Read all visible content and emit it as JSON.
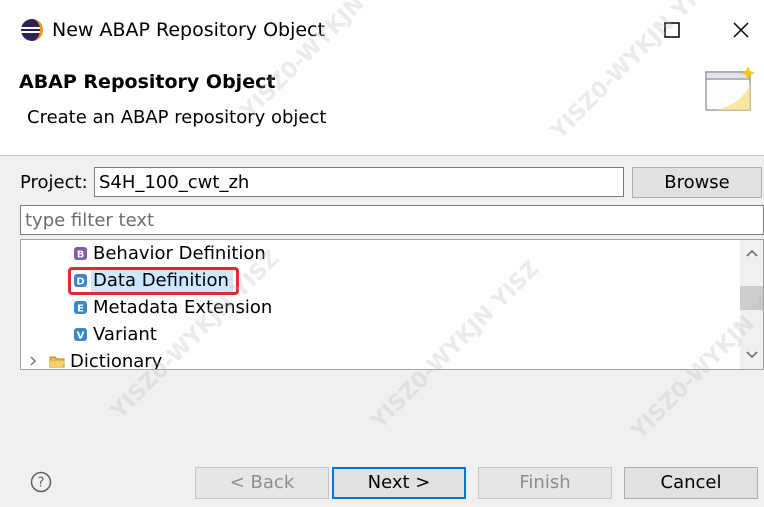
{
  "window": {
    "title": "New ABAP Repository Object",
    "controls": [
      "maximize-icon",
      "close-icon"
    ]
  },
  "header": {
    "title": "ABAP Repository Object",
    "description": "Create an ABAP repository object",
    "icon": "wizard-banner-icon"
  },
  "project": {
    "label": "Project:",
    "value": "S4H_100_cwt_zh",
    "browse_label": "Browse"
  },
  "filter": {
    "placeholder": "type filter text"
  },
  "tree": {
    "items": [
      {
        "label": "Behavior Definition",
        "icon": "behavior-definition-icon",
        "letter": "B"
      },
      {
        "label": "Data Definition",
        "icon": "data-definition-icon",
        "letter": "D",
        "selected": true
      },
      {
        "label": "Metadata Extension",
        "icon": "metadata-extension-icon",
        "letter": "E"
      },
      {
        "label": "Variant",
        "icon": "variant-icon",
        "letter": "V"
      },
      {
        "label": "Dictionary",
        "icon": "folder-icon",
        "expander": "chevron-right-icon"
      }
    ]
  },
  "footer": {
    "help_icon": "help-icon",
    "back_label": "< Back",
    "next_label": "Next >",
    "finish_label": "Finish",
    "cancel_label": "Cancel"
  },
  "watermark": {
    "text": "YISZ0-WYKJN YISZ"
  },
  "colors": {
    "highlight": "#e8262d",
    "selection": "#cce8ff",
    "default_button_border": "#0078d7"
  }
}
